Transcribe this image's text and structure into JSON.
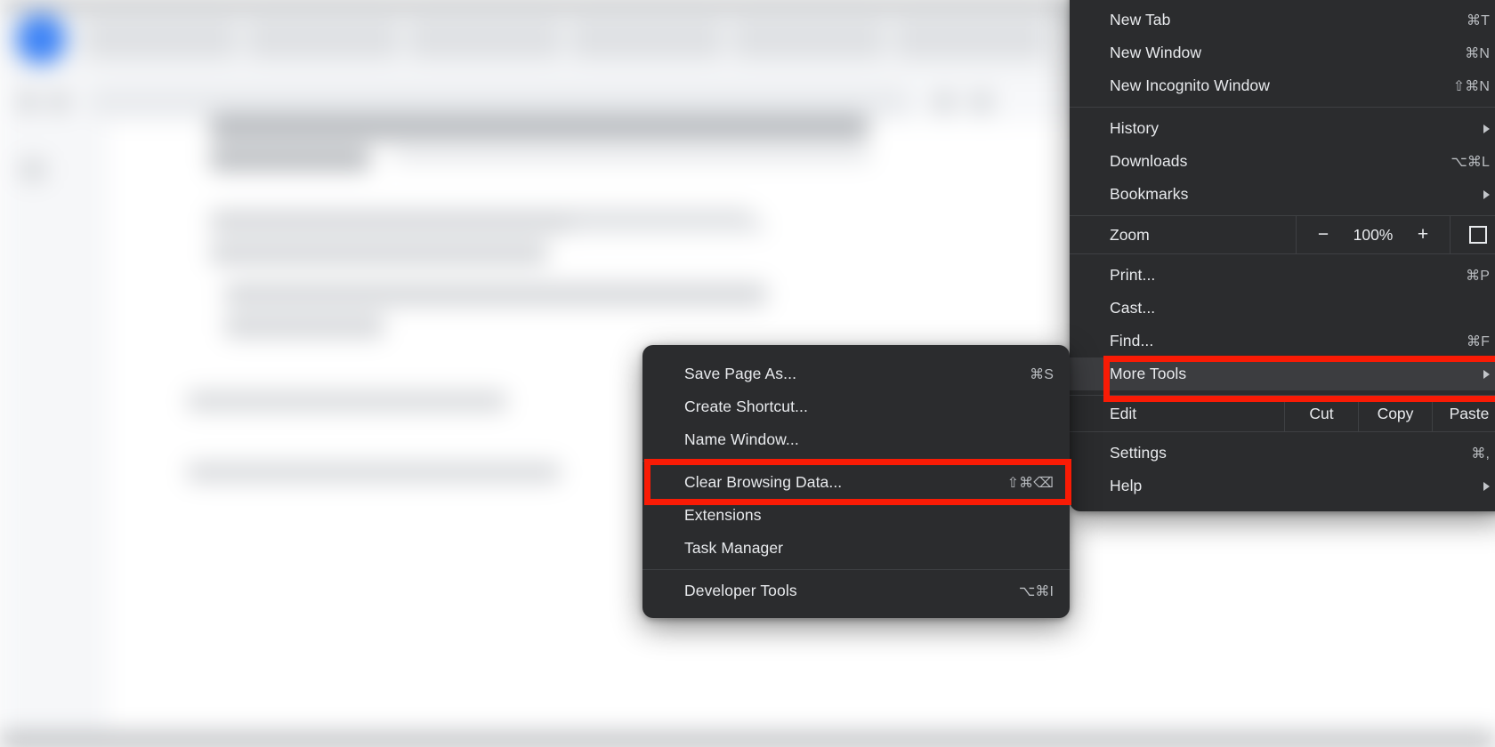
{
  "background": {
    "description": "Blurred browser window behind the open menus"
  },
  "chrome_menu": {
    "name": "Chrome main menu",
    "items": [
      {
        "label": "New Tab",
        "accel": "⌘T",
        "submenu": false,
        "highlight": false
      },
      {
        "label": "New Window",
        "accel": "⌘N",
        "submenu": false,
        "highlight": false
      },
      {
        "label": "New Incognito Window",
        "accel": "⇧⌘N",
        "submenu": false,
        "highlight": false
      },
      {
        "label": "History",
        "accel": "",
        "submenu": true,
        "highlight": false
      },
      {
        "label": "Downloads",
        "accel": "⌥⌘L",
        "submenu": false,
        "highlight": false
      },
      {
        "label": "Bookmarks",
        "accel": "",
        "submenu": true,
        "highlight": false
      },
      {
        "label": "Print...",
        "accel": "⌘P",
        "submenu": false,
        "highlight": false
      },
      {
        "label": "Cast...",
        "accel": "",
        "submenu": false,
        "highlight": false
      },
      {
        "label": "Find...",
        "accel": "⌘F",
        "submenu": false,
        "highlight": false
      },
      {
        "label": "More Tools",
        "accel": "",
        "submenu": true,
        "highlight": true
      },
      {
        "label": "Settings",
        "accel": "⌘,",
        "submenu": false,
        "highlight": false
      },
      {
        "label": "Help",
        "accel": "",
        "submenu": true,
        "highlight": false
      }
    ],
    "zoom_row": {
      "label": "Zoom",
      "minus": "−",
      "value": "100%",
      "plus": "+",
      "fullscreen_icon": "fullscreen-icon"
    },
    "edit_row": {
      "label": "Edit",
      "cut": "Cut",
      "copy": "Copy",
      "paste": "Paste"
    }
  },
  "more_tools_submenu": {
    "name": "More Tools submenu",
    "items": [
      {
        "label": "Save Page As...",
        "accel": "⌘S",
        "highlight": false
      },
      {
        "label": "Create Shortcut...",
        "accel": "",
        "highlight": false
      },
      {
        "label": "Name Window...",
        "accel": "",
        "highlight": false
      },
      {
        "label": "Clear Browsing Data...",
        "accel": "⇧⌘⌫",
        "highlight": true
      },
      {
        "label": "Extensions",
        "accel": "",
        "highlight": false
      },
      {
        "label": "Task Manager",
        "accel": "",
        "highlight": false
      },
      {
        "label": "Developer Tools",
        "accel": "⌥⌘I",
        "highlight": false
      }
    ]
  },
  "annotations": {
    "highlight_color": "#f91b05",
    "boxes": [
      {
        "target": "More Tools"
      },
      {
        "target": "Clear Browsing Data..."
      }
    ]
  }
}
